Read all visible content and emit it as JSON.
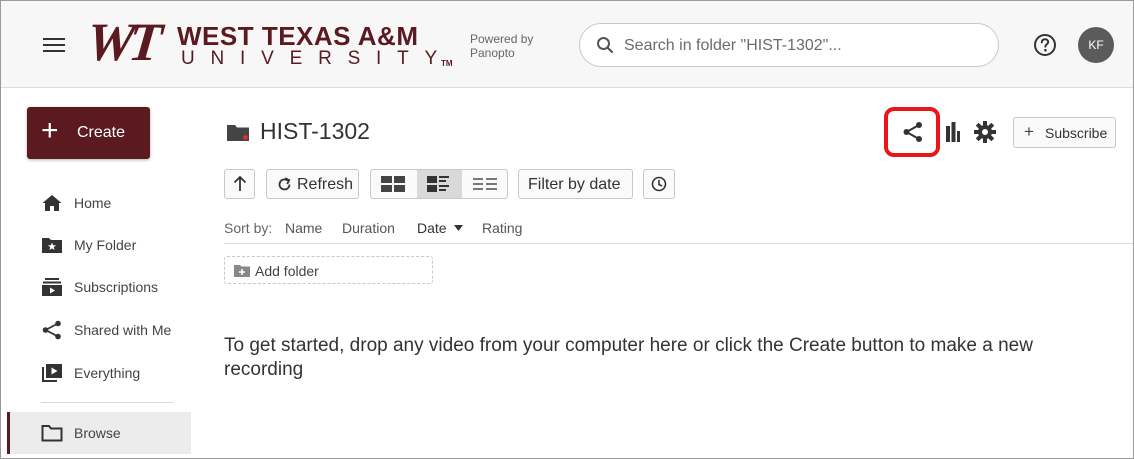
{
  "header": {
    "logo_mark": "WT",
    "logo_name": "WEST TEXAS A&M",
    "logo_sub": "UNIVERSITY",
    "logo_tm": "TM",
    "powered_by": "Powered by Panopto",
    "search_placeholder": "Search in folder \"HIST-1302\"...",
    "avatar_initials": "KF"
  },
  "sidebar": {
    "create_label": "Create",
    "items": [
      {
        "label": "Home",
        "icon": "home-icon"
      },
      {
        "label": "My Folder",
        "icon": "my-folder-icon"
      },
      {
        "label": "Subscriptions",
        "icon": "subscriptions-icon"
      },
      {
        "label": "Shared with Me",
        "icon": "share-icon"
      },
      {
        "label": "Everything",
        "icon": "everything-icon"
      },
      {
        "label": "Browse",
        "icon": "folder-icon"
      }
    ]
  },
  "main": {
    "folder_title": "HIST-1302",
    "subscribe_label": "Subscribe",
    "toolbar": {
      "refresh_label": "Refresh",
      "filter_label": "Filter by date"
    },
    "sort": {
      "prefix": "Sort by:",
      "options": [
        "Name",
        "Duration",
        "Date",
        "Rating"
      ],
      "active": "Date"
    },
    "add_folder_label": "Add folder",
    "empty_message": "To get started, drop any video from your computer here or click the Create button to make a new recording"
  },
  "colors": {
    "brand": "#5a1a20",
    "highlight": "#e8151b"
  }
}
